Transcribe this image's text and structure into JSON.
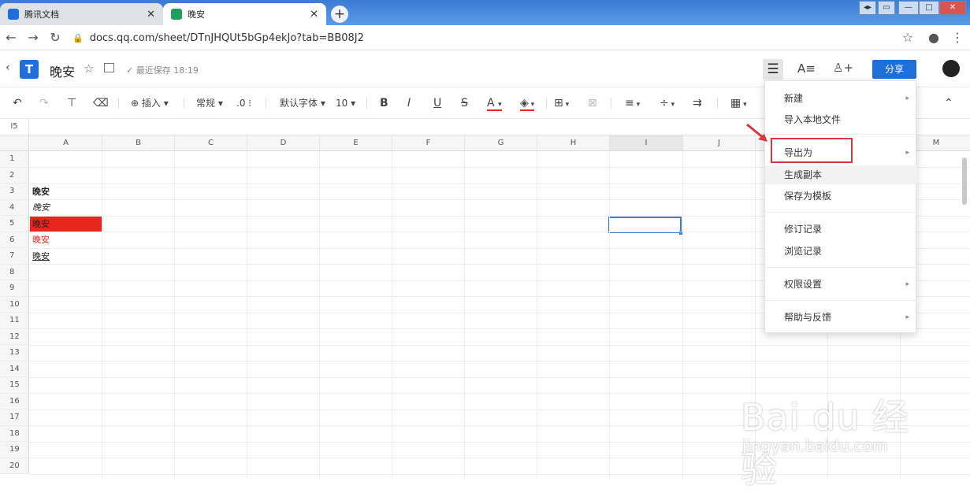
{
  "browser": {
    "tabs": [
      {
        "label": "腾讯文档",
        "active": false
      },
      {
        "label": "晚安",
        "active": true
      }
    ],
    "url": "docs.qq.com/sheet/DTnJHQUt5bGp4ekJo?tab=BB08J2"
  },
  "header": {
    "doc_title": "晚安",
    "saved_status": "最近保存 18:19",
    "share_label": "分享"
  },
  "toolbar": {
    "insert": "插入",
    "format": "常规",
    "decimal": ".0",
    "font": "默认字体",
    "size": "10",
    "bold": "B",
    "italic": "I",
    "underline": "U",
    "strike": "S",
    "font_color": "A"
  },
  "formula_bar": {
    "cell_ref": "I5",
    "value": ""
  },
  "grid": {
    "columns": [
      "A",
      "B",
      "C",
      "D",
      "E",
      "F",
      "G",
      "H",
      "I",
      "J",
      "K",
      "L",
      "M"
    ],
    "rows": [
      "1",
      "2",
      "3",
      "4",
      "5",
      "6",
      "7",
      "8",
      "9",
      "10",
      "11",
      "12",
      "13",
      "14",
      "15",
      "16",
      "17",
      "18",
      "19",
      "20"
    ],
    "cells": {
      "A3": {
        "text": "晚安",
        "style": "bold"
      },
      "A4": {
        "text": "晚安",
        "style": "italic"
      },
      "A5": {
        "text": "晚安",
        "style": "red-fill"
      },
      "A6": {
        "text": "晚安",
        "style": "red-text"
      },
      "A7": {
        "text": "晚安",
        "style": "underline"
      }
    },
    "selected_cell": "I5"
  },
  "menu": {
    "items": [
      {
        "label": "新建",
        "submenu": true
      },
      {
        "label": "导入本地文件",
        "submenu": false
      },
      {
        "label": "导出为",
        "submenu": true
      },
      {
        "label": "生成副本",
        "submenu": false
      },
      {
        "label": "保存为模板",
        "submenu": false
      },
      {
        "label": "修订记录",
        "submenu": false
      },
      {
        "label": "浏览记录",
        "submenu": false
      },
      {
        "label": "权限设置",
        "submenu": true
      },
      {
        "label": "帮助与反馈",
        "submenu": true
      }
    ],
    "highlighted": "导出为"
  },
  "watermark": {
    "line1": "Bai du 经验",
    "line2": "jingyan.baidu.com"
  },
  "colors": {
    "accent": "#1e6fd9",
    "highlight_box": "#d9363e",
    "fill_red": "#e8261c"
  }
}
